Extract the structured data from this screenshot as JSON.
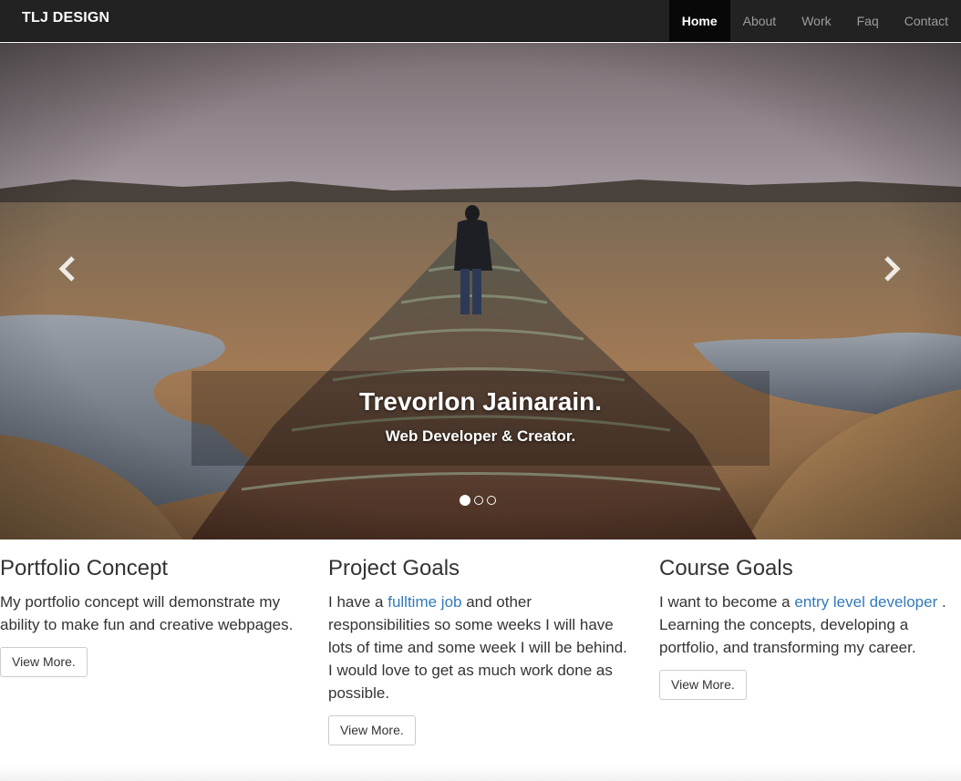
{
  "navbar": {
    "brand": "TLJ DESIGN",
    "items": [
      {
        "label": "Home",
        "active": true
      },
      {
        "label": "About"
      },
      {
        "label": "Work"
      },
      {
        "label": "Faq"
      },
      {
        "label": "Contact"
      }
    ]
  },
  "carousel": {
    "title": "Trevorlon Jainarain.",
    "subtitle": "Web Developer & Creator.",
    "prev_icon": "chevron-left-icon",
    "next_icon": "chevron-right-icon",
    "slide_count": 3,
    "active_slide": 1
  },
  "columns": [
    {
      "heading": "Portfolio Concept",
      "text_before": "My portfolio concept will demonstrate my ability to make fun and creative webpages.",
      "link": "",
      "text_after": "",
      "button": "View More."
    },
    {
      "heading": "Project Goals",
      "text_before": "I have a ",
      "link": "fulltime job",
      "text_after": " and other responsibilities so some weeks I will have lots of time and some week I will be behind. I would love to get as much work done as possible.",
      "button": "View More."
    },
    {
      "heading": "Course Goals",
      "text_before": "I want to become a ",
      "link": "entry level developer",
      "text_after": " . Learning the concepts, developing a portfolio, and transforming my career.",
      "button": "View More."
    }
  ],
  "colors": {
    "navbar_bg": "#222222",
    "link": "#337ab7",
    "text": "#333333"
  }
}
